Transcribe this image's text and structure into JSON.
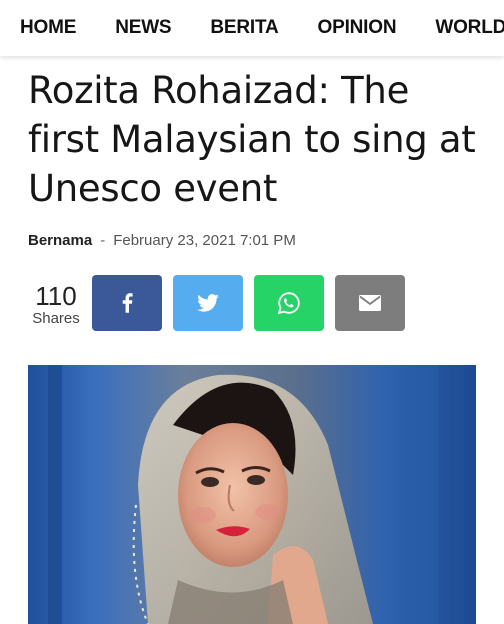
{
  "nav": {
    "items": [
      "HOME",
      "NEWS",
      "BERITA",
      "OPINION",
      "WORLD"
    ]
  },
  "article": {
    "title": "Rozita Rohaizad: The first Malaysian to sing at Unesco event",
    "author": "Bernama",
    "separator": "-",
    "date": "February 23, 2021 7:01 PM"
  },
  "share": {
    "count": "110",
    "count_label": "Shares",
    "buttons": [
      {
        "name": "facebook",
        "icon": "facebook-icon",
        "color": "#3b5998"
      },
      {
        "name": "twitter",
        "icon": "twitter-icon",
        "color": "#55acee"
      },
      {
        "name": "whatsapp",
        "icon": "whatsapp-icon",
        "color": "#25d366"
      },
      {
        "name": "email",
        "icon": "mail-icon",
        "color": "#7d7d7d"
      }
    ]
  },
  "hero_image": {
    "subject": "portrait-photo"
  }
}
